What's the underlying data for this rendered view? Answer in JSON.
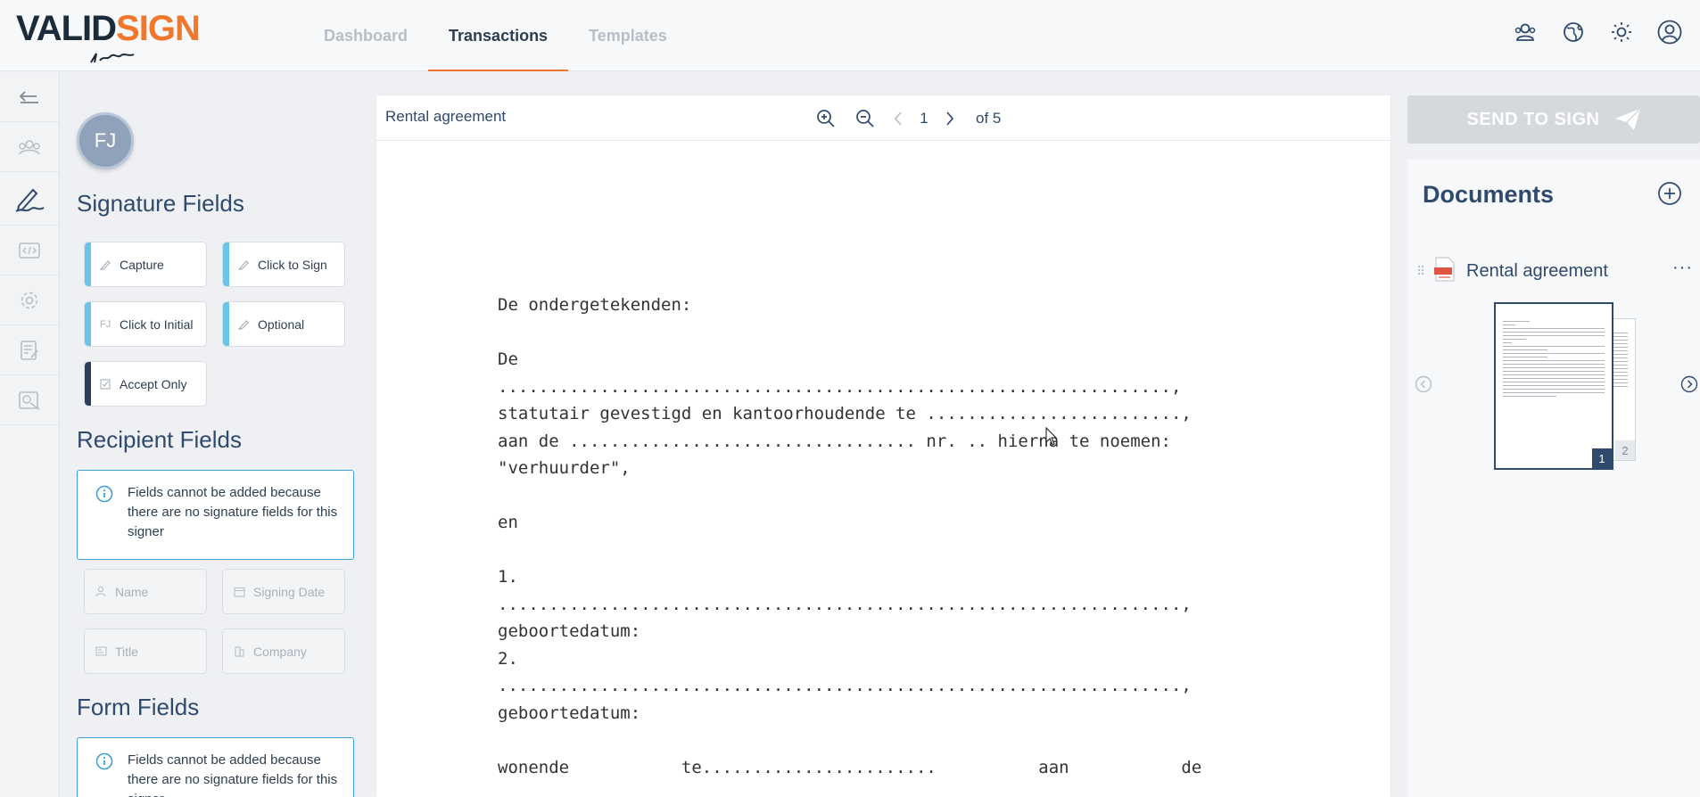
{
  "app": {
    "logo": {
      "part1": "VALID",
      "part2": "SIGN"
    },
    "colors": {
      "accent": "#f0772b",
      "primary": "#2f4a6c",
      "info": "#3fa0d8",
      "field_bar": "#6cc3e8"
    }
  },
  "nav": {
    "items": [
      {
        "label": "Dashboard",
        "active": false
      },
      {
        "label": "Transactions",
        "active": true
      },
      {
        "label": "Templates",
        "active": false
      }
    ]
  },
  "top_icons": [
    "users-icon",
    "globe-icon",
    "sun-icon",
    "account-icon"
  ],
  "rail": {
    "items": [
      "back-icon",
      "recipients-icon",
      "signature-pen-icon",
      "code-icon",
      "settings-icon",
      "form-icon",
      "stamp-icon"
    ]
  },
  "fields_panel": {
    "avatar_initials": "FJ",
    "signature_title": "Signature Fields",
    "signature_fields": [
      {
        "label": "Capture",
        "icon": "pen-icon"
      },
      {
        "label": "Click to Sign",
        "icon": "pen-icon"
      },
      {
        "label": "Click to Initial",
        "icon": "initials-icon",
        "icon_text": "FJ"
      },
      {
        "label": "Optional",
        "icon": "pen-icon"
      },
      {
        "label": "Accept Only",
        "icon": "checkbox-icon"
      }
    ],
    "recipient_title": "Recipient Fields",
    "recipient_notice": "Fields cannot be added because there are no signature fields for this signer",
    "recipient_fields": [
      {
        "label": "Name",
        "icon": "person-icon"
      },
      {
        "label": "Signing Date",
        "icon": "calendar-icon"
      },
      {
        "label": "Title",
        "icon": "id-card-icon"
      },
      {
        "label": "Company",
        "icon": "building-icon"
      }
    ],
    "form_title": "Form Fields",
    "form_notice": "Fields cannot be added because there are no signature fields for this signer"
  },
  "viewer": {
    "doc_title": "Rental agreement",
    "current_page": "1",
    "page_total": "of 5",
    "body_lines": [
      "De ondergetekenden:",
      "",
      "De",
      "..................................................................,",
      "statutair gevestigd en kantoorhoudende te .........................,",
      "aan de .................................. nr. .. hierna te noemen:",
      "\"verhuurder\",",
      "",
      "en",
      "",
      "1.",
      "...................................................................,",
      "geboortedatum:",
      "2.",
      "...................................................................,",
      "geboortedatum:",
      "",
      "wonende           te.......................          aan           de"
    ]
  },
  "right_panel": {
    "send_label": "SEND TO SIGN",
    "documents_title": "Documents",
    "document_name": "Rental agreement",
    "more_label": "···",
    "thumbs": [
      {
        "page": "1",
        "active": true
      },
      {
        "page": "2",
        "active": false
      }
    ]
  }
}
